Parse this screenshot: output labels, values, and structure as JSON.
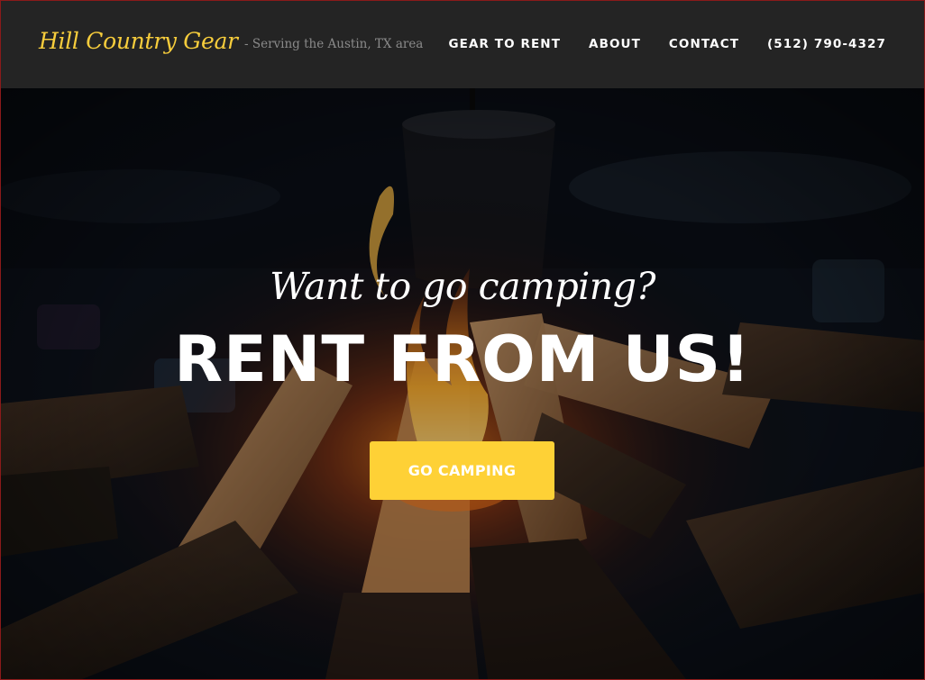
{
  "colors": {
    "navbar_bg": "#242424",
    "brand": "#f7cd3c",
    "tagline": "#8a8a8a",
    "nav_text": "#ffffff",
    "cta_bg": "#fed136",
    "cta_text": "#ffffff",
    "hero_text": "#ffffff"
  },
  "navbar": {
    "brand": "Hill Country Gear",
    "tagline": "- Serving the Austin, TX area",
    "links": [
      {
        "label": "GEAR TO RENT"
      },
      {
        "label": "ABOUT"
      },
      {
        "label": "CONTACT"
      },
      {
        "label": "(512) 790-4327"
      }
    ]
  },
  "hero": {
    "background_image": "campfire-with-logs-and-pot",
    "subheading": "Want to go camping?",
    "heading": "RENT FROM US!",
    "cta_label": "GO CAMPING"
  }
}
